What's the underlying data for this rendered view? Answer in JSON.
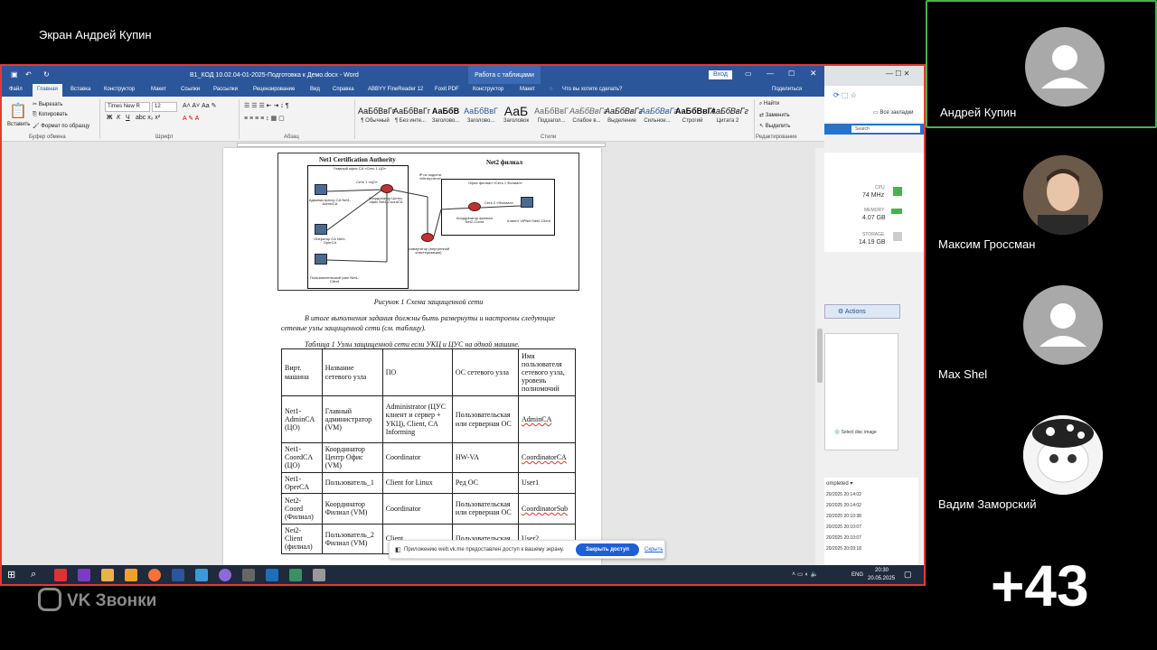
{
  "share": {
    "title": "Экран Андрей Купин"
  },
  "word": {
    "title": "В1_КОД 10.02.04-01-2025-Подготовка к Демо.docx - Word",
    "context_tab": "Работа с таблицами",
    "login": "Вход",
    "menu": [
      "Файл",
      "Главная",
      "Вставка",
      "Конструктор",
      "Макет",
      "Ссылки",
      "Рассылки",
      "Рецензирование",
      "Вид",
      "Справка",
      "ABBYY FineReader 12",
      "Foxit PDF",
      "Конструктор",
      "Макет"
    ],
    "tellme": "Что вы хотите сделать?",
    "share_btn": "Поделиться",
    "clipboard": {
      "paste": "Вставить",
      "cut": "Вырезать",
      "copy": "Копировать",
      "format": "Формат по образцу",
      "group": "Буфер обмена"
    },
    "font": {
      "name": "Times New R",
      "size": "12",
      "group": "Шрифт"
    },
    "paragraph_group": "Абзац",
    "styles": [
      {
        "sample": "АаБбВвГг",
        "label": "¶ Обычный"
      },
      {
        "sample": "АаБбВвГг",
        "label": "¶ Без инте..."
      },
      {
        "sample": "АаБбВ",
        "label": "Заголово..."
      },
      {
        "sample": "АаБбВвГ",
        "label": "Заголово..."
      },
      {
        "sample": "АаБ",
        "label": "Заголовок"
      },
      {
        "sample": "АаБбВвГ",
        "label": "Подзагол..."
      },
      {
        "sample": "АаБбВвГг",
        "label": "Слабое в..."
      },
      {
        "sample": "АаБбВвГг",
        "label": "Выделение"
      },
      {
        "sample": "АаБбВвГг",
        "label": "Сильное..."
      },
      {
        "sample": "АаБбВвГг",
        "label": "Строгий"
      },
      {
        "sample": "АаБбВвГг",
        "label": "Цитата 2"
      }
    ],
    "styles_group": "Стили",
    "editing": {
      "find": "Найти",
      "replace": "Заменить",
      "select": "Выделить",
      "group": "Редактирование"
    }
  },
  "diagram": {
    "net1_title": "Net1 Certification Authority",
    "net2_title": "Net2 филиал",
    "main_office": "Главный офис СА «Сеть 1 ЦО»",
    "net1_lan": "Сеть 1 «ЦО»",
    "internet": "IP из подсети «Интернета»",
    "branch_office": "Офис филиал «Сеть 1 Филиал»",
    "net2_lan": "Сеть 2 «Филиал»",
    "admin_ca": "Администратор СА Net1-AdminCA",
    "coord_ca": "Координатор Центр. офис Net1-CoordCA",
    "oper_ca": "Оператор СА Net1-OperCA",
    "net1_user": "Пользовательский узел Net1-Client",
    "switch": "Коммутатор (внутренний кластеризации)",
    "coord_branch": "Координатор филиал Net2-Coord",
    "client_branch": "Клиент ViPNet Net2-Client"
  },
  "doc": {
    "figure_caption": "Рисунок 1 Схема защищенной сети",
    "para": "В итоге выполнения задания должны быть развернуты и настроены следующие сетевые узлы защищенной сети (см. таблицу).",
    "table_caption": "Таблица 1 Узлы защищенной сети если УКЦ и ЦУС на одной машине.",
    "headers": [
      "Вирт. машина",
      "Название сетевого узла",
      "ПО",
      "ОС сетевого узла",
      "Имя пользователя сетевого узла, уровень полномочий"
    ],
    "rows": [
      [
        "Net1-AdminCA (ЦО)",
        "Главный администратор (VM)",
        "Administrator (ЦУС клиент и сервер + УКЦ), Client, CA Informing",
        "Пользовательская или серверная ОС",
        "AdminCA"
      ],
      [
        "Net1-CoordCA (ЦО)",
        "Координатор Центр Офис (VM)",
        "Coordinator",
        "HW-VA",
        "CoordinatorCA"
      ],
      [
        "Net1-OperCA",
        "Пользователь_1",
        "Client for Linux",
        "Ред ОС",
        "User1"
      ],
      [
        "Net2-Coord (Филиал)",
        "Координатор Филиал (VM)",
        "Coordinator",
        "Пользовательская или серверная ОС",
        "CoordinatorSub"
      ],
      [
        "Net2-Client (филиал)",
        "Пользователь_2 Филиал (VM)",
        "Client",
        "Пользовательская",
        "User2"
      ]
    ]
  },
  "browser": {
    "bookmarks": "Все закладки",
    "search": "Search",
    "cpu_label": "CPU",
    "cpu_val": "74 MHz",
    "mem_label": "MEMORY",
    "mem_val": "4.07 GB",
    "storage_label": "STORAGE",
    "storage_val": "14.19 GB",
    "actions": "Actions",
    "disc": "Select disc image",
    "completed": "ompleted",
    "times": [
      "20/2025 20:14:02",
      "20/2025 20:14:02",
      "20/2025 20:10:38",
      "20/2025 20:10:07",
      "20/2025 20:10:07",
      "20/2025 20:09:18"
    ]
  },
  "notify": {
    "text": "Приложению web.vk.me предоставлен доступ к вашему экрану.",
    "stop": "Закрыть доступ",
    "hide": "Скрыть"
  },
  "taskbar": {
    "lang": "ENG",
    "time": "20:30",
    "date": "20.05.2025"
  },
  "app": {
    "logo": "VK Звонки"
  },
  "participants": [
    {
      "name": "Андрей Купин"
    },
    {
      "name": "Максим Гроссман"
    },
    {
      "name": "Max Shel"
    },
    {
      "name": "Вадим Заморский"
    }
  ],
  "more": "+43",
  "colors": {
    "word_blue": "#2b579a",
    "share_border": "#e53935",
    "active_speaker": "#4caf50"
  }
}
